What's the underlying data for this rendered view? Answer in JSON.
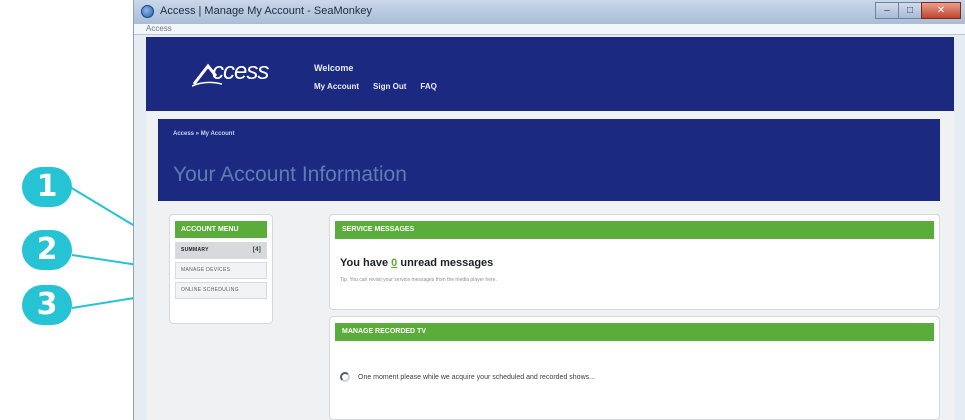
{
  "callouts": [
    "1",
    "2",
    "3"
  ],
  "window": {
    "title": "Access | Manage My Account - SeaMonkey",
    "address_text": "Access"
  },
  "header": {
    "logo_text": "ccess",
    "logo_tagline": "",
    "welcome": "Welcome",
    "nav": [
      "My Account",
      "Sign Out",
      "FAQ"
    ]
  },
  "banner": {
    "breadcrumb": "Access » My Account",
    "title": "Your Account Information"
  },
  "menu": {
    "header": "ACCOUNT MENU",
    "items": [
      {
        "label": "SUMMARY",
        "badge": "[4]",
        "active": true
      },
      {
        "label": "MANAGE DEVICES",
        "active": false
      },
      {
        "label": "ONLINE SCHEDULING",
        "active": false
      }
    ]
  },
  "service_messages": {
    "header": "SERVICE MESSAGES",
    "prefix": "You have",
    "count": "0",
    "suffix": "unread messages",
    "tip": "Tip: You can revisit your service messages from the media player here."
  },
  "recorded_tv": {
    "header": "MANAGE RECORDED TV",
    "loading_text": "One moment please while we acquire your scheduled and recorded shows..."
  },
  "colors": {
    "accent_green": "#5aad3a",
    "brand_navy": "#1b2a80",
    "callout_cyan": "#25c3d3"
  }
}
